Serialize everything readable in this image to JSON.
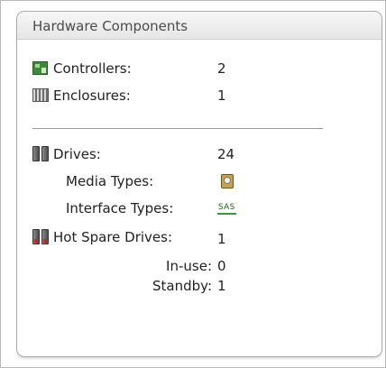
{
  "panel": {
    "title": "Hardware Components"
  },
  "summary": {
    "controllers": {
      "label": "Controllers:",
      "value": "2",
      "icon": "controller-icon"
    },
    "enclosures": {
      "label": "Enclosures:",
      "value": "1",
      "icon": "enclosure-icon"
    },
    "drives": {
      "label": "Drives:",
      "value": "24",
      "icon": "drive-icon"
    },
    "media_types": {
      "label": "Media Types:",
      "icon": "hard-disk-icon"
    },
    "interface_types": {
      "label": "Interface Types:",
      "badge": "SAS",
      "icon": "sas-badge-icon"
    },
    "hot_spare": {
      "label": "Hot Spare Drives:",
      "value": "1",
      "icon": "hot-spare-drive-icon"
    },
    "in_use": {
      "label": "In-use:",
      "value": "0"
    },
    "standby": {
      "label": "Standby:",
      "value": "1"
    }
  },
  "colors": {
    "panel_border": "#a9a9a9",
    "header_bg": "#ececec",
    "text": "#222222",
    "sas_green": "#3a9a3a",
    "spare_red": "#d32020"
  }
}
